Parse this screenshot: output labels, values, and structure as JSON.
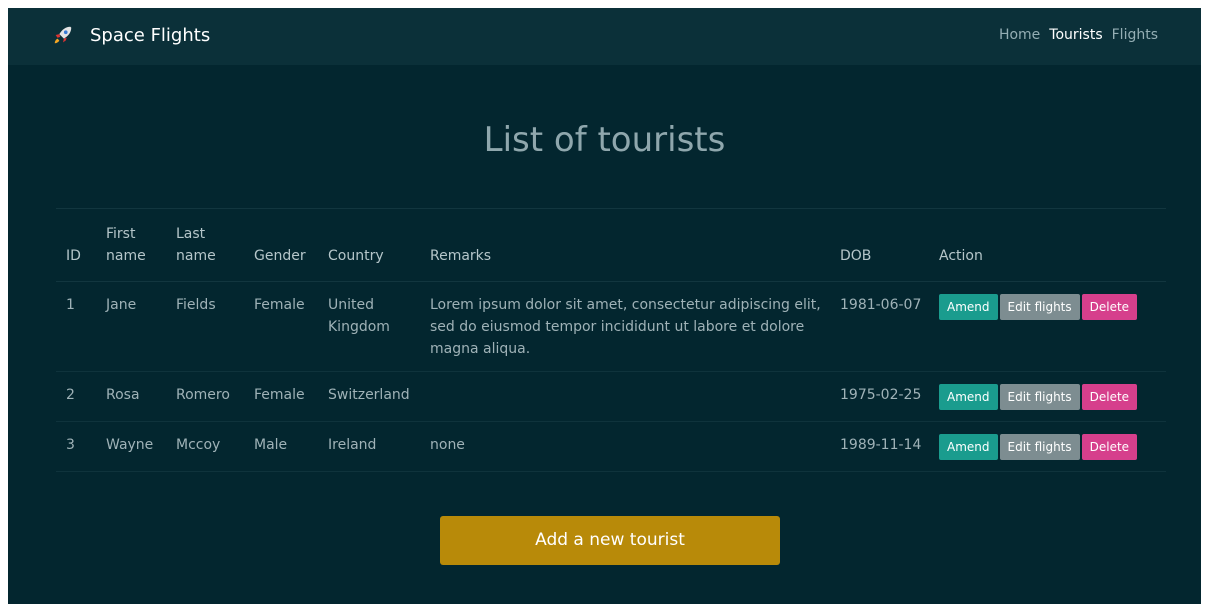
{
  "app": {
    "brand": "Space Flights",
    "nav": [
      {
        "label": "Home"
      },
      {
        "label": "Tourists"
      },
      {
        "label": "Flights"
      }
    ]
  },
  "page": {
    "title": "List of tourists"
  },
  "table": {
    "headers": [
      "ID",
      "First name",
      "Last name",
      "Gender",
      "Country",
      "Remarks",
      "DOB",
      "Action"
    ],
    "rows": [
      {
        "id": "1",
        "first": "Jane",
        "last": "Fields",
        "gender": "Female",
        "country": "United Kingdom",
        "remarks": "Lorem ipsum dolor sit amet, consectetur adipiscing elit, sed do eiusmod tempor incididunt ut labore et dolore magna aliqua.",
        "dob": "1981-06-07"
      },
      {
        "id": "2",
        "first": "Rosa",
        "last": "Romero",
        "gender": "Female",
        "country": "Switzerland",
        "remarks": "",
        "dob": "1975-02-25"
      },
      {
        "id": "3",
        "first": "Wayne",
        "last": "Mccoy",
        "gender": "Male",
        "country": "Ireland",
        "remarks": "none",
        "dob": "1989-11-14"
      }
    ],
    "actions": {
      "amend": "Amend",
      "edit_flights": "Edit flights",
      "delete": "Delete"
    }
  },
  "add_button": "Add a new tourist",
  "colors": {
    "background": "#03262f",
    "navbar": "#0b3039",
    "amend": "#1a9c8e",
    "edit": "#7d8d91",
    "delete": "#d63f8c",
    "add": "#b88a09"
  }
}
